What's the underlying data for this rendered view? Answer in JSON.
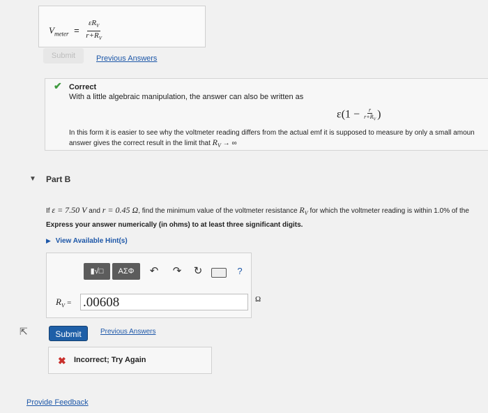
{
  "prev_answer": {
    "lhs_symbol": "V",
    "lhs_subscript": "meter",
    "equals": "=",
    "numerator": "εR",
    "numerator_sub": "V",
    "denominator": "r+R",
    "denominator_sub": "V"
  },
  "part_a": {
    "submit_label": "Submit",
    "previous_answers_label": "Previous Answers"
  },
  "feedback": {
    "title": "Correct",
    "line1": "With a little algebraic manipulation, the answer can also be written as",
    "formula_prefix": "ε(1 −",
    "formula_num": "r",
    "formula_den": "r+R",
    "formula_den_sub": "V",
    "formula_suffix": ")",
    "line2": "In this form it is easier to see why the voltmeter reading differs from the actual emf it is supposed to measure by only a small amoun",
    "line3_prefix": "answer gives the correct result in the limit that",
    "line3_math": "R",
    "line3_math_sub": "V",
    "line3_suffix": "→ ∞"
  },
  "part_b": {
    "title": "Part B",
    "q_text1": "If",
    "q_emf": "ε = 7.50 V",
    "q_text2": "and",
    "q_r": "r = 0.45 Ω",
    "q_text3": ", find the minimum value of the voltmeter resistance",
    "q_rv": "R",
    "q_rv_sub": "V",
    "q_text4": "for which the voltmeter reading is within 1.0% of the",
    "instruction": "Express your answer numerically (in ohms) to at least three significant digits.",
    "hints_label": "View Available Hint(s)",
    "toolbar": {
      "templates_label": "▮√□",
      "greek_label": "AΣΦ",
      "help_label": "?"
    },
    "input_label": "R",
    "input_label_sub": "V",
    "input_equals": "=",
    "input_value": ".00608",
    "unit": "Ω",
    "submit_label": "Submit",
    "previous_answers_label": "Previous Answers",
    "result_text": "Incorrect; Try Again"
  },
  "footer": {
    "provide_feedback": "Provide Feedback"
  }
}
